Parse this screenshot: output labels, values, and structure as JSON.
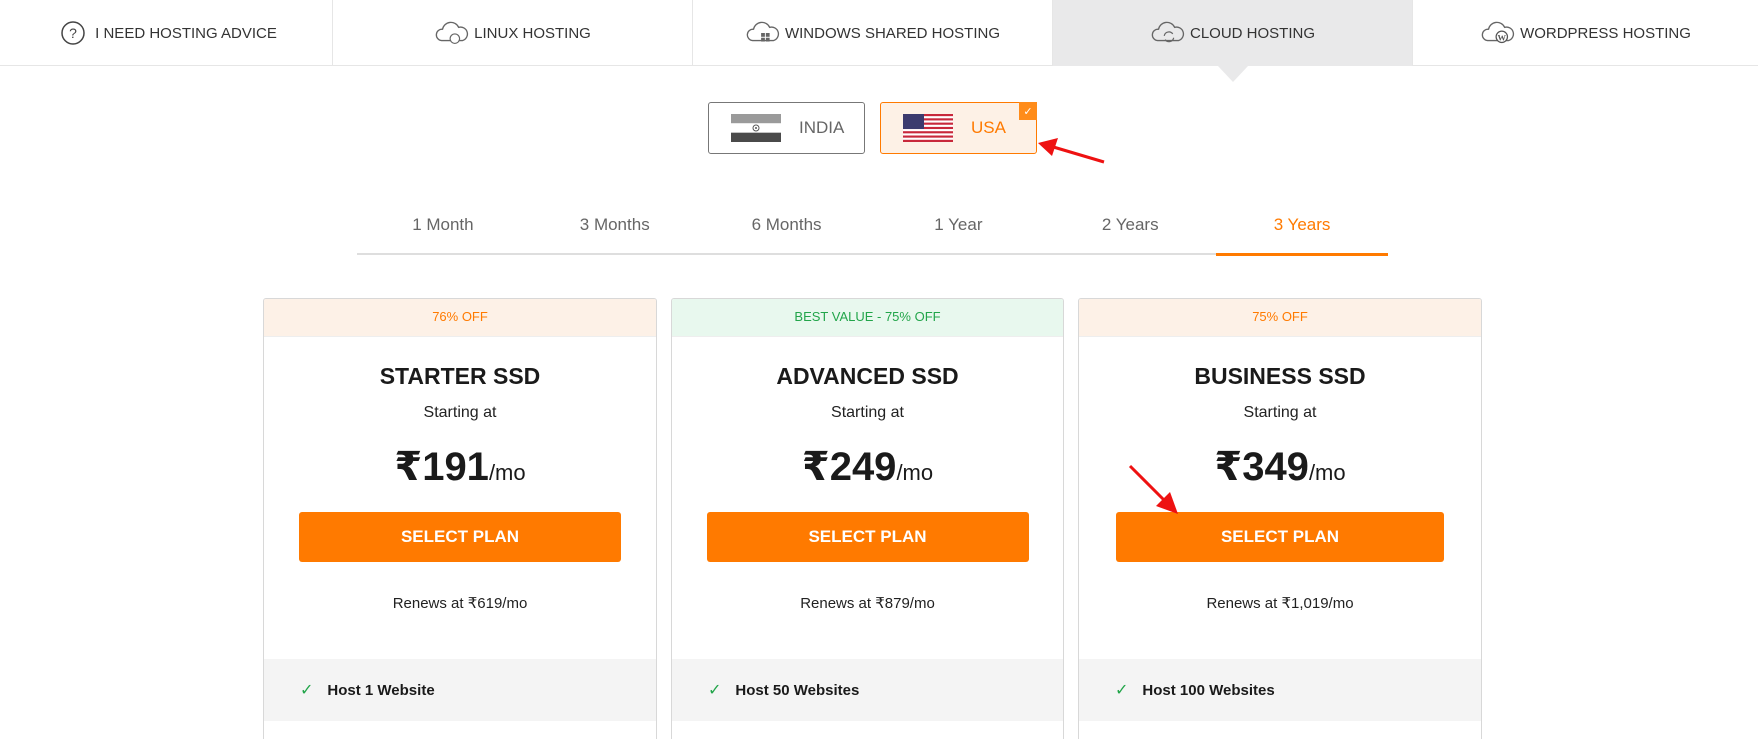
{
  "tabs": [
    {
      "label": "I NEED HOSTING ADVICE",
      "icon": "question-circle-icon"
    },
    {
      "label": "LINUX HOSTING",
      "icon": "cloud-linux-icon"
    },
    {
      "label": "WINDOWS SHARED HOSTING",
      "icon": "cloud-windows-icon"
    },
    {
      "label": "CLOUD HOSTING",
      "icon": "cloud-sync-icon",
      "active": true
    },
    {
      "label": "WORDPRESS HOSTING",
      "icon": "cloud-wordpress-icon"
    }
  ],
  "regions": [
    {
      "label": "INDIA",
      "icon": "india-flag-icon",
      "selected": false
    },
    {
      "label": "USA",
      "icon": "usa-flag-icon",
      "selected": true
    }
  ],
  "periods": [
    {
      "label": "1 Month"
    },
    {
      "label": "3 Months"
    },
    {
      "label": "6 Months"
    },
    {
      "label": "1 Year"
    },
    {
      "label": "2 Years"
    },
    {
      "label": "3 Years",
      "active": true
    }
  ],
  "plans": [
    {
      "ribbon": "76% OFF",
      "ribbon_color": "#ff7a00",
      "name": "STARTER SSD",
      "starting": "Starting at",
      "price": "₹191",
      "per": "/mo",
      "button": "SELECT PLAN",
      "renews": "Renews at ₹619/mo",
      "feature": "Host 1 Website"
    },
    {
      "ribbon": "BEST VALUE - 75% OFF",
      "ribbon_color": "#22a54a",
      "name": "ADVANCED SSD",
      "starting": "Starting at",
      "price": "₹249",
      "per": "/mo",
      "button": "SELECT PLAN",
      "renews": "Renews at ₹879/mo",
      "feature": "Host 50 Websites"
    },
    {
      "ribbon": "75% OFF",
      "ribbon_color": "#ff7a00",
      "name": "BUSINESS SSD",
      "starting": "Starting at",
      "price": "₹349",
      "per": "/mo",
      "button": "SELECT PLAN",
      "renews": "Renews at ₹1,019/mo",
      "feature": "Host 100 Websites"
    }
  ],
  "colors": {
    "accent": "#ff7a00",
    "success": "#22a54a",
    "annotation_arrow": "#ee1111"
  }
}
